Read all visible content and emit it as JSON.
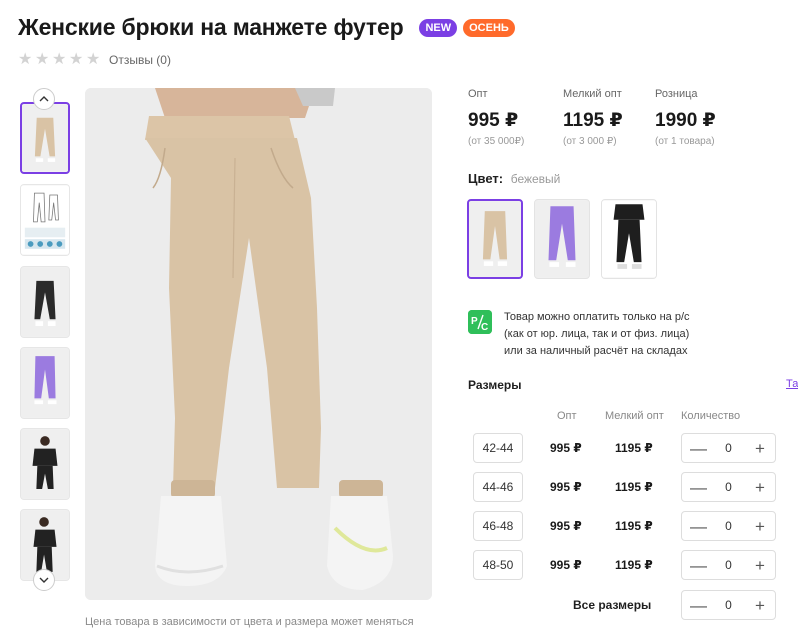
{
  "product": {
    "title": "Женские брюки на манжете футер",
    "badges": {
      "new": "NEW",
      "season": "ОСЕНЬ"
    },
    "rating": {
      "stars": 0,
      "max": 5,
      "reviews_label": "Отзывы (0)"
    }
  },
  "gallery": {
    "thumbnails": [
      "beige",
      "size-chart",
      "black",
      "lilac",
      "black-set",
      "black-set-2"
    ],
    "active_index": 0,
    "note": "Цена товара в зависимости от цвета и размера может меняться"
  },
  "prices": [
    {
      "label": "Опт",
      "value": "995 ₽",
      "sub": "(от 35 000₽)"
    },
    {
      "label": "Мелкий опт",
      "value": "1195 ₽",
      "sub": "(от 3 000 ₽)"
    },
    {
      "label": "Розница",
      "value": "1990 ₽",
      "sub": "(от 1 товара)"
    }
  ],
  "color": {
    "label": "Цвет:",
    "value": "бежевый",
    "swatches": [
      "beige",
      "lilac",
      "black"
    ],
    "colors": {
      "beige": "#d9c3a5",
      "lilac": "#9b7be0",
      "black": "#1e1e1e"
    }
  },
  "payment_note": {
    "icon": "Р/С",
    "lines": [
      "Товар можно оплатить только на р/с",
      "(как от юр. лица, так и от физ. лица)",
      "или за наличный расчёт на складах"
    ]
  },
  "sizes": {
    "title": "Размеры",
    "link": "Та",
    "headers": {
      "opt": "Опт",
      "small_opt": "Мелкий опт",
      "qty": "Количество"
    },
    "rows": [
      {
        "size": "42-44",
        "opt": "995 ₽",
        "small_opt": "1195 ₽",
        "qty": "0"
      },
      {
        "size": "44-46",
        "opt": "995 ₽",
        "small_opt": "1195 ₽",
        "qty": "0"
      },
      {
        "size": "46-48",
        "opt": "995 ₽",
        "small_opt": "1195 ₽",
        "qty": "0"
      },
      {
        "size": "48-50",
        "opt": "995 ₽",
        "small_opt": "1195 ₽",
        "qty": "0"
      }
    ],
    "all": {
      "label": "Все размеры",
      "qty": "0"
    },
    "minus": "—",
    "plus": "+"
  },
  "accent": "#7b3fe4"
}
